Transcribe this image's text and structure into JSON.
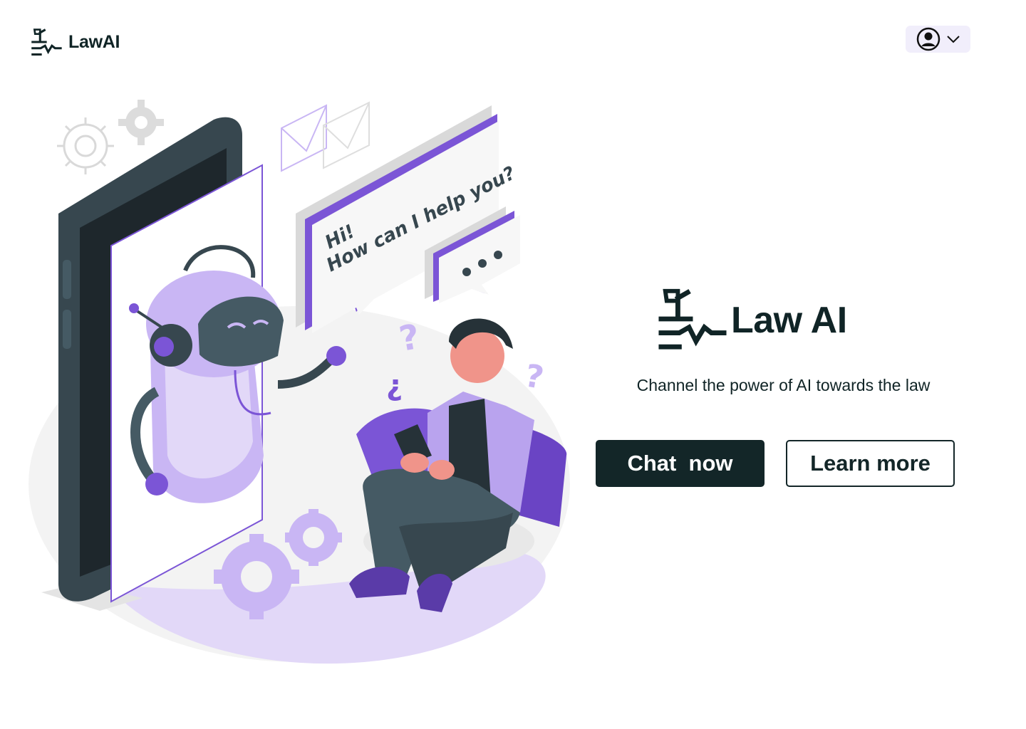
{
  "header": {
    "brand_name": "LawAI",
    "logo_icon": "sprout-pulse-icon",
    "account_icon": "user-circle-icon",
    "account_menu_icon": "chevron-down-icon"
  },
  "hero": {
    "brand_name": "Law AI",
    "tagline": "Channel the power of AI towards the law",
    "primary_button": "Chat  now",
    "secondary_button": "Learn more"
  },
  "illustration": {
    "speech_bubble_line1": "Hi!",
    "speech_bubble_line2": "How can I help you?",
    "typing_dots": "•••",
    "question_mark": "?",
    "inverted_question_mark": "¿"
  },
  "colors": {
    "brand_dark": "#102426",
    "accent_purple": "#7b55d6",
    "light_purple": "#b9a3ee",
    "account_bg": "#f1eefb"
  }
}
